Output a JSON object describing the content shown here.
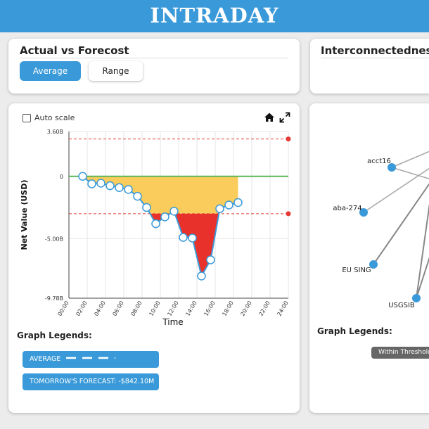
{
  "header": {
    "title": "INTRADAY"
  },
  "left_top_card": {
    "title": "Actual vs Forecost",
    "buttons": {
      "average": "Average",
      "range": "Range"
    }
  },
  "right_top_card": {
    "title": "Interconnectedness"
  },
  "chart_card": {
    "auto_scale_label": "Auto scale",
    "graph_legends_title": "Graph Legends:",
    "legend_average": "AVERAGE",
    "legend_forecast": "TOMORROW'S FORECAST: -$842.10M"
  },
  "network_card": {
    "graph_legends_title": "Graph Legends:",
    "threshold_label": "Within Threshold",
    "nodes": [
      "acct16",
      "aba-274",
      "EU SING",
      "USGSIB"
    ]
  },
  "colors": {
    "accent": "#3a9ad9",
    "zero_line": "#5ab55a",
    "threshold": "#e53935",
    "fill_within": "#f9cc5b",
    "fill_breach": "#e8312a"
  },
  "icons": [
    "home-icon",
    "expand-icon",
    "checkbox-icon"
  ],
  "chart_data": {
    "type": "line",
    "xlabel": "Time",
    "ylabel": "Net Value (USD)",
    "y_tick_labels": [
      "3.60B",
      "0",
      "-5.00B",
      "-9.78B"
    ],
    "y_tick_values": [
      3.6,
      0,
      -5.0,
      -9.78
    ],
    "ylim": [
      -9.78,
      3.6
    ],
    "x_tick_labels": [
      "00:00",
      "02:00",
      "04:00",
      "06:00",
      "08:00",
      "10:00",
      "12:00",
      "14:00",
      "16:00",
      "18:00",
      "20:00",
      "22:00",
      "24:00"
    ],
    "xlim": [
      0,
      24
    ],
    "thresholds": {
      "upper": 3.0,
      "lower": -3.0
    },
    "grid": true,
    "series": [
      {
        "x": [
          1.5,
          2.5,
          3.5,
          4.5,
          5.5,
          6.5,
          7.5,
          8.5,
          9.5,
          10.5,
          11.5,
          12.5,
          13.5,
          14.5,
          15.5,
          16.5,
          17.5,
          18.5
        ],
        "values": [
          0.0,
          -0.6,
          -0.55,
          -0.75,
          -0.9,
          -1.05,
          -1.6,
          -2.5,
          -3.8,
          -3.25,
          -2.8,
          -4.9,
          -4.95,
          -8.0,
          -6.7,
          -2.6,
          -2.3,
          -2.1
        ]
      }
    ]
  }
}
